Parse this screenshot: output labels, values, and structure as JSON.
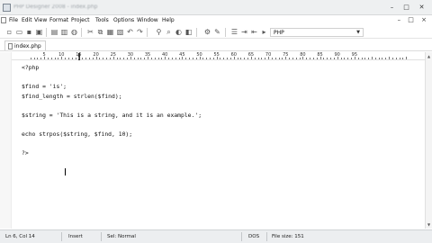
{
  "window": {
    "title": "PHP Designer 2008 - index.php",
    "controls": [
      "–",
      "□",
      "✕"
    ]
  },
  "menu": {
    "items": [
      "File",
      "Edit",
      "View",
      "Format",
      "Project",
      "Tools",
      "Options",
      "Window",
      "Help"
    ],
    "mdi_controls": "– □ ×"
  },
  "toolbar": {
    "icons": [
      "new-file",
      "open-folder",
      "save",
      "save-all",
      "cut",
      "copy",
      "paste",
      "undo",
      "redo",
      "find",
      "replace",
      "preview",
      "browser",
      "settings"
    ],
    "syntax_value": "PHP"
  },
  "tabs": [
    {
      "label": "index.php"
    }
  ],
  "ruler": {
    "labels": [
      "5",
      "10",
      "15",
      "20",
      "25",
      "30",
      "35",
      "40",
      "45",
      "50",
      "55",
      "60",
      "65",
      "70",
      "75",
      "80",
      "85",
      "90",
      "95"
    ]
  },
  "editor": {
    "lines": [
      "<?php",
      "",
      "$find = 'is';",
      "$find_length = strlen($find);",
      "",
      "$string = 'This is a string, and it is an example.';",
      "",
      "echo strpos($string, $find, 10);",
      "",
      "?>"
    ]
  },
  "status": {
    "position": "Ln 6, Col 14",
    "mode": "Insert",
    "sel_mode": "Sel: Normal",
    "eol": "DOS",
    "file_size": "File size: 151"
  }
}
